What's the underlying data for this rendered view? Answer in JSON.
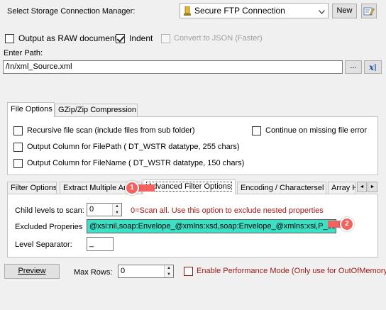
{
  "connection": {
    "label": "Select Storage Connection Manager:",
    "selected": "Secure FTP Connection",
    "new_label": "New"
  },
  "options": {
    "raw_label": "Output as RAW document",
    "indent_label": "Indent",
    "json_label": "Convert to JSON (Faster)"
  },
  "path": {
    "label": "Enter Path:",
    "value": "/In/xml_Source.xml",
    "browse_label": "..."
  },
  "file_tabs": {
    "tab1": "File Options",
    "tab2": "GZip/Zip Compression"
  },
  "file_options": {
    "recursive": "Recursive file scan (include files from sub folder)",
    "continue_missing": "Continue on missing file error",
    "filepath": "Output Column for FilePath ( DT_WSTR datatype, 255 chars)",
    "filename": "Output Column for FileName ( DT_WSTR datatype, 150 chars)"
  },
  "filter_tabs": {
    "tab1": "Filter Options",
    "tab2": "Extract Multiple Ar",
    "tab3": "Advanced Filter Options",
    "tab4": "Encoding / Charactersel",
    "tab5": "Array H",
    "scroll_left": "◄",
    "scroll_right": "►"
  },
  "advanced": {
    "child_label": "Child levels to scan:",
    "child_value": "0",
    "child_hint": "0=Scan all. Use this option to exclude nested properties",
    "excluded_label": "Excluded Properies",
    "excluded_value": "@xsi:nil,soap:Envelope_@xmlns:xsd,soap:Envelope_@xmlns:xsi,P_soap",
    "separator_label": "Level Separator:",
    "separator_value": "_"
  },
  "footer": {
    "preview_label": "Preview",
    "maxrows_label": "Max Rows:",
    "maxrows_value": "0",
    "perf_label": "Enable Performance Mode (Only use for OutOfMemory e"
  },
  "callouts": {
    "one": "1",
    "two": "2"
  },
  "colors": {
    "accent_red": "#f2625f",
    "highlight_cyan": "#3ee0c5",
    "hint_red": "#a01818"
  }
}
